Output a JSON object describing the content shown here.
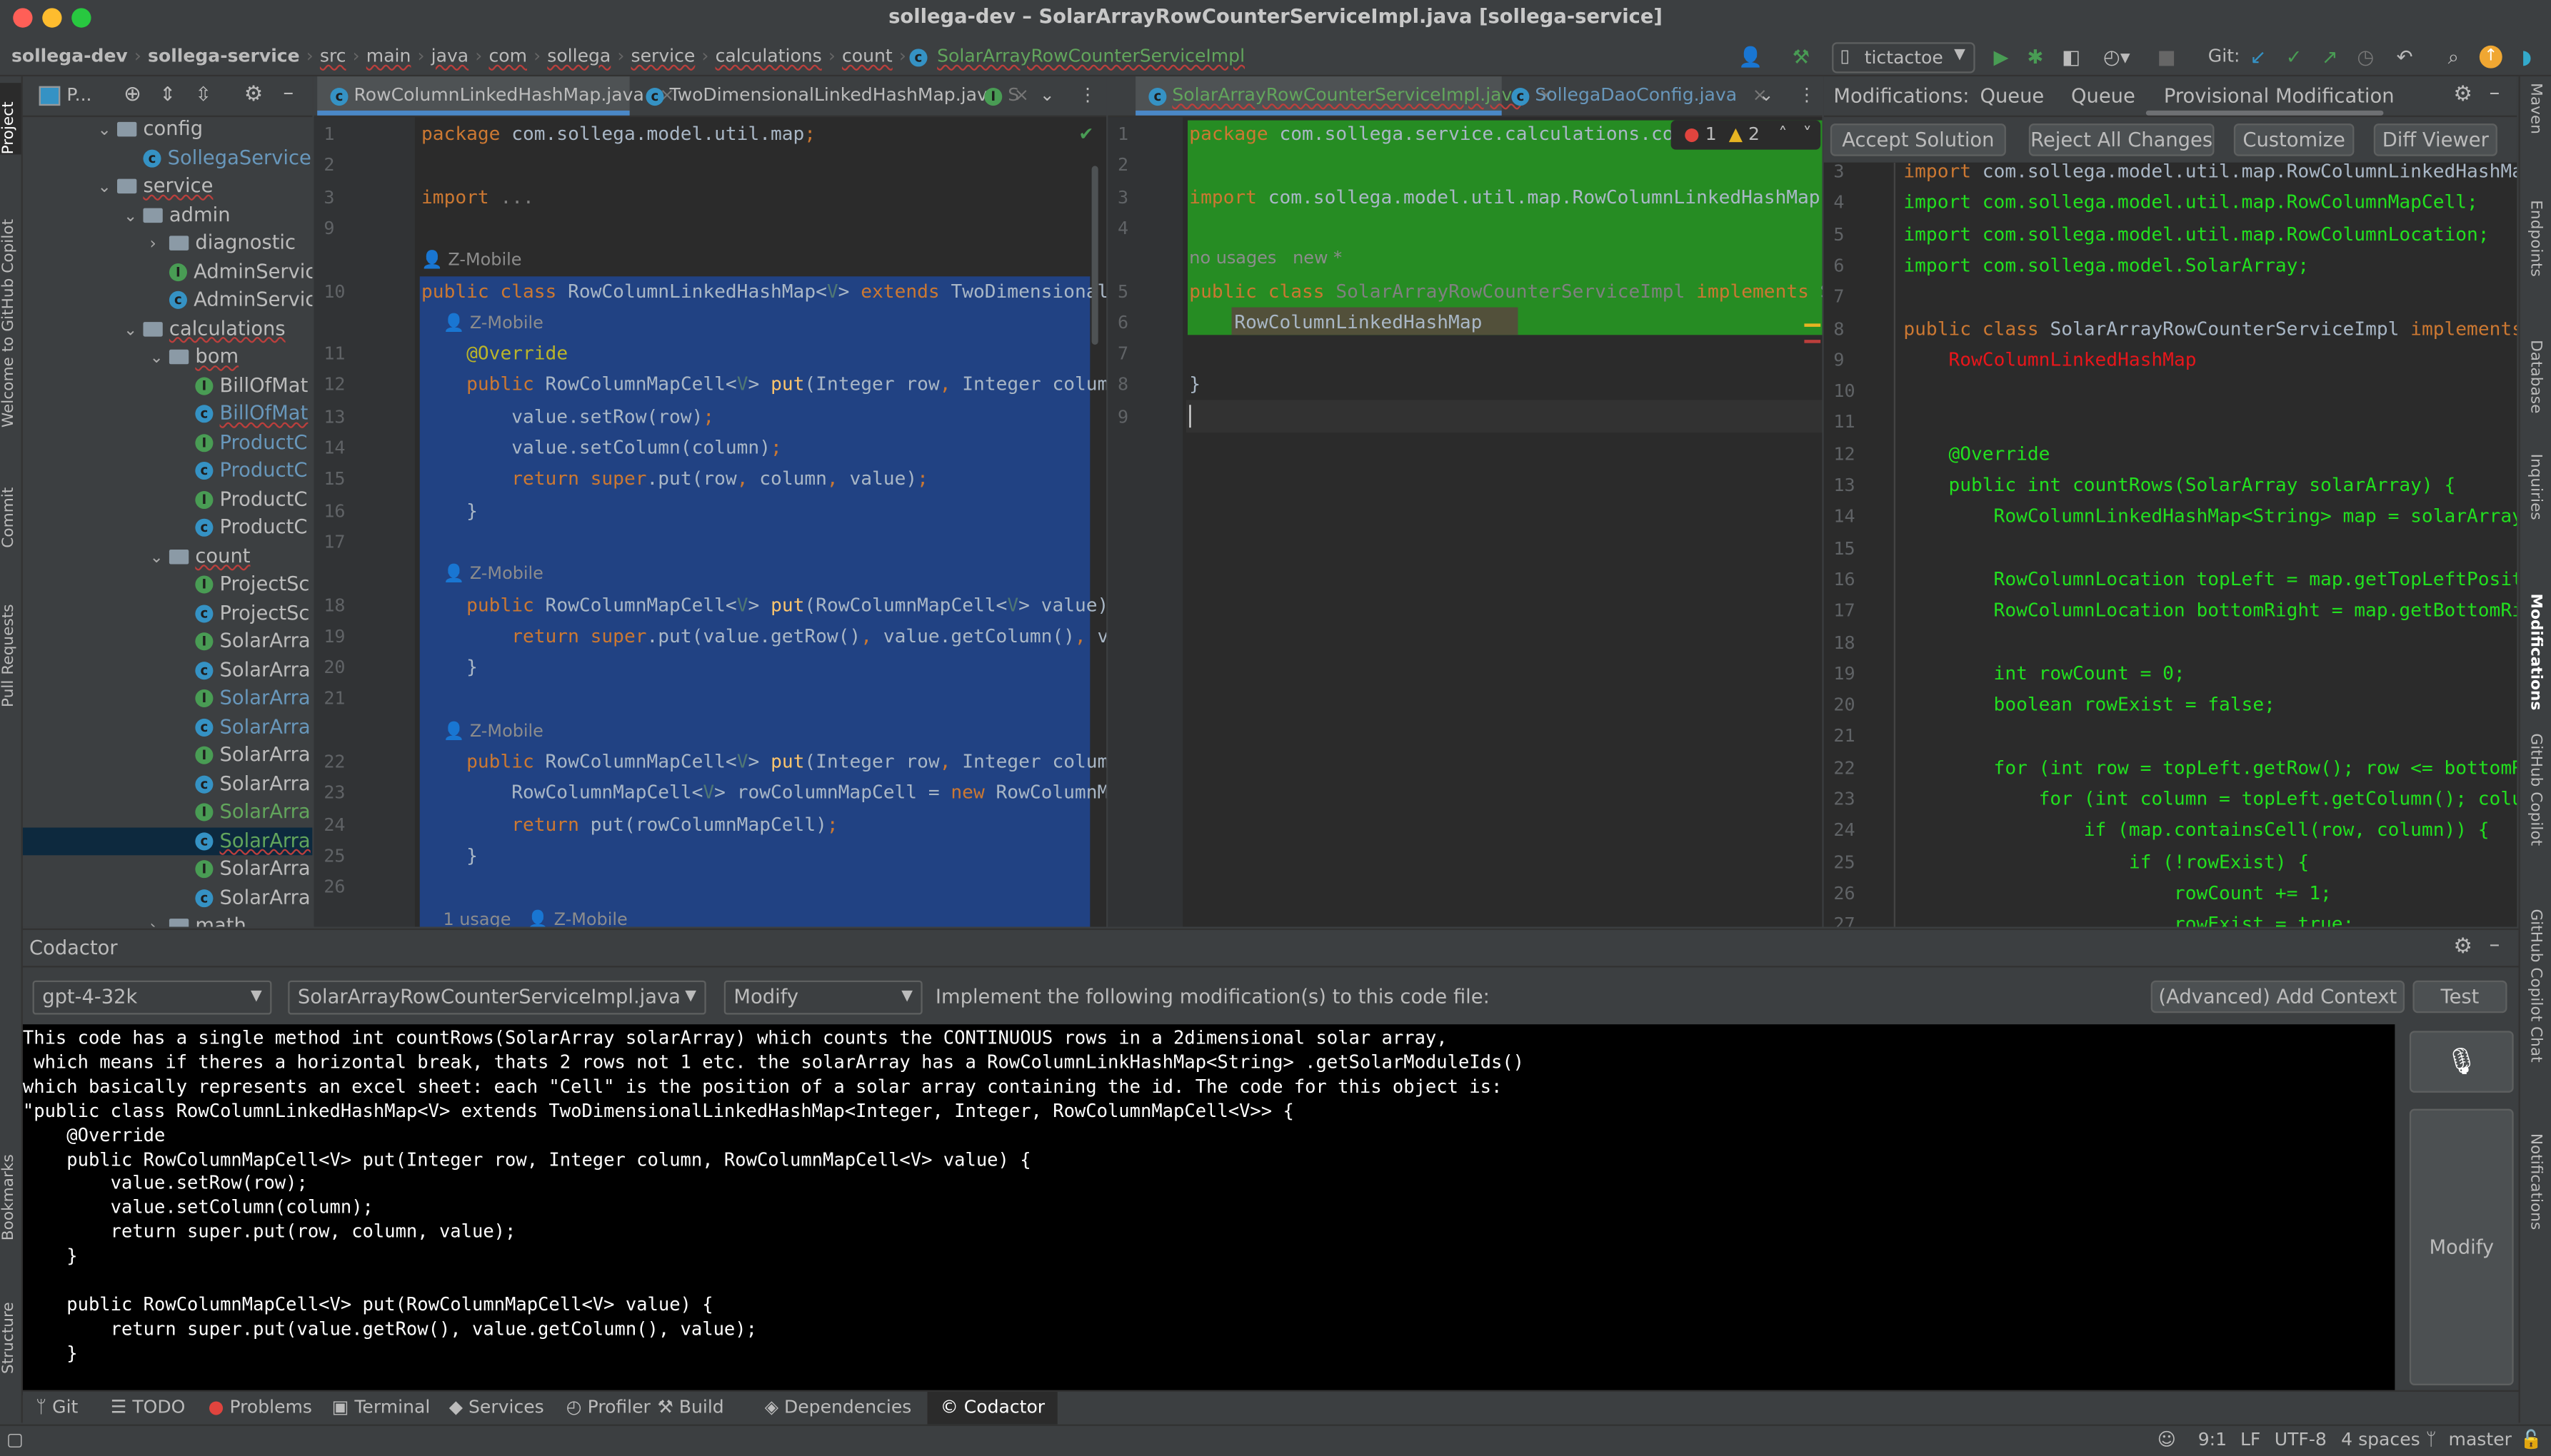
{
  "window": {
    "title": "sollega-dev – SolarArrayRowCounterServiceImpl.java [sollega-service]"
  },
  "breadcrumb": [
    "sollega-dev",
    "sollega-service",
    "src",
    "main",
    "java",
    "com",
    "sollega",
    "service",
    "calculations",
    "count",
    "SolarArrayRowCounterServiceImpl"
  ],
  "toolbar": {
    "run_config": "tictactoe",
    "git_label": "Git:"
  },
  "left_strip": [
    "Project",
    "Welcome to GitHub Copilot",
    "Commit",
    "Pull Requests",
    "Bookmarks",
    "Structure"
  ],
  "right_strip": [
    "Maven",
    "Endpoints",
    "Database",
    "Inquiries",
    "Modifications",
    "GitHub Copilot",
    "GitHub Copilot Chat",
    "Notifications"
  ],
  "project": {
    "title": "P...",
    "tree": [
      {
        "label": "config",
        "type": "folder",
        "depth": 0,
        "expanded": true
      },
      {
        "label": "SollegaService",
        "type": "class",
        "depth": 1,
        "color": "blue"
      },
      {
        "label": "service",
        "type": "folder",
        "depth": 0,
        "expanded": true,
        "underline": true
      },
      {
        "label": "admin",
        "type": "folder",
        "depth": 1,
        "expanded": true
      },
      {
        "label": "diagnostic",
        "type": "folder",
        "depth": 2,
        "expanded": false
      },
      {
        "label": "AdminServic",
        "type": "interface",
        "depth": 2
      },
      {
        "label": "AdminServic",
        "type": "class",
        "depth": 2
      },
      {
        "label": "calculations",
        "type": "folder",
        "depth": 1,
        "expanded": true,
        "underline": true
      },
      {
        "label": "bom",
        "type": "folder",
        "depth": 2,
        "expanded": true,
        "underline": true
      },
      {
        "label": "BillOfMat",
        "type": "interface",
        "depth": 3
      },
      {
        "label": "BillOfMat",
        "type": "class",
        "depth": 3,
        "color": "blue",
        "underline": true
      },
      {
        "label": "ProductC",
        "type": "interface",
        "depth": 3,
        "color": "blue"
      },
      {
        "label": "ProductC",
        "type": "class",
        "depth": 3,
        "color": "blue"
      },
      {
        "label": "ProductC",
        "type": "interface",
        "depth": 3
      },
      {
        "label": "ProductC",
        "type": "class",
        "depth": 3
      },
      {
        "label": "count",
        "type": "folder",
        "depth": 2,
        "expanded": true,
        "underline": true
      },
      {
        "label": "ProjectSc",
        "type": "interface",
        "depth": 3
      },
      {
        "label": "ProjectSc",
        "type": "class",
        "depth": 3
      },
      {
        "label": "SolarArra",
        "type": "interface",
        "depth": 3
      },
      {
        "label": "SolarArra",
        "type": "class",
        "depth": 3
      },
      {
        "label": "SolarArra",
        "type": "interface",
        "depth": 3,
        "color": "blue"
      },
      {
        "label": "SolarArra",
        "type": "class",
        "depth": 3,
        "color": "blue"
      },
      {
        "label": "SolarArra",
        "type": "interface",
        "depth": 3
      },
      {
        "label": "SolarArra",
        "type": "class",
        "depth": 3
      },
      {
        "label": "SolarArra",
        "type": "interface",
        "depth": 3,
        "color": "green"
      },
      {
        "label": "SolarArra",
        "type": "class",
        "depth": 3,
        "color": "green",
        "selected": true,
        "underline": true
      },
      {
        "label": "SolarArra",
        "type": "interface",
        "depth": 3
      },
      {
        "label": "SolarArra",
        "type": "class",
        "depth": 3
      },
      {
        "label": "math",
        "type": "folder",
        "depth": 2,
        "expanded": false
      }
    ]
  },
  "editor_left": {
    "tabs": [
      {
        "label": "RowColumnLinkedHashMap.java",
        "icon": "class",
        "active": true
      },
      {
        "label": "TwoDimensionalLinkedHashMap.java",
        "icon": "class"
      },
      {
        "label": "S",
        "icon": "interface"
      }
    ],
    "lines": [
      {
        "n": "1",
        "html": "<span class='kw'>package</span> com.sollega.model.util.map<span class='kw'>;</span>"
      },
      {
        "n": "2",
        "html": ""
      },
      {
        "n": "3",
        "html": "<span class='kw'>import</span> <span class='gr'>...</span>"
      },
      {
        "n": "9",
        "html": ""
      },
      {
        "hint": "Z-Mobile"
      },
      {
        "n": "10",
        "html": "<span class='kw'>public class</span> RowColumnLinkedHashMap&lt;<span class='tp'>V</span>&gt; <span class='kw'>extends</span> TwoDimensionalLinkedHashMap"
      },
      {
        "hint": "    Z-Mobile"
      },
      {
        "n": "11",
        "html": "    <span class='ann'>@Override</span>"
      },
      {
        "n": "12",
        "html": "    <span class='kw'>public</span> RowColumnMapCell&lt;<span class='tp'>V</span>&gt; <span class='fn'>put</span>(Integer row<span class='kw'>,</span> Integer column"
      },
      {
        "n": "13",
        "html": "        value.setRow(row)<span class='kw'>;</span>"
      },
      {
        "n": "14",
        "html": "        value.setColumn(column)<span class='kw'>;</span>"
      },
      {
        "n": "15",
        "html": "        <span class='kw'>return super</span>.put(row<span class='kw'>,</span> column<span class='kw'>,</span> value)<span class='kw'>;</span>"
      },
      {
        "n": "16",
        "html": "    }"
      },
      {
        "n": "17",
        "html": ""
      },
      {
        "hint": "    Z-Mobile"
      },
      {
        "n": "18",
        "html": "    <span class='kw'>public</span> RowColumnMapCell&lt;<span class='tp'>V</span>&gt; <span class='fn'>put</span>(RowColumnMapCell&lt;<span class='tp'>V</span>&gt; value) {"
      },
      {
        "n": "19",
        "html": "        <span class='kw'>return super</span>.put(value.getRow()<span class='kw'>,</span> value.getColumn()<span class='kw'>,</span> value)<span class='kw'>;</span>"
      },
      {
        "n": "20",
        "html": "    }"
      },
      {
        "n": "21",
        "html": ""
      },
      {
        "hint": "    Z-Mobile"
      },
      {
        "n": "22",
        "html": "    <span class='kw'>public</span> RowColumnMapCell&lt;<span class='tp'>V</span>&gt; <span class='fn'>put</span>(Integer row<span class='kw'>,</span> Integer column"
      },
      {
        "n": "23",
        "html": "        RowColumnMapCell&lt;<span class='tp'>V</span>&gt; rowColumnMapCell = <span class='kw'>new</span> RowColumnMapCell"
      },
      {
        "n": "24",
        "html": "        <span class='kw'>return</span> put(rowColumnMapCell)<span class='kw'>;</span>"
      },
      {
        "n": "25",
        "html": "    }"
      },
      {
        "n": "26",
        "html": ""
      },
      {
        "hint": "    1 usage   Z-Mobile"
      }
    ]
  },
  "editor_right": {
    "tabs": [
      {
        "label": "SolarArrayRowCounterServiceImpl.java",
        "icon": "class",
        "active": true
      },
      {
        "label": "SollegaDaoConfig.java",
        "icon": "class"
      }
    ],
    "inspections": {
      "errors": "1",
      "warnings": "2"
    },
    "lines": [
      {
        "n": "1",
        "html": "<span class='kw'>package</span> com.sollega.service.calculations.count<span class='kw'>;</span>"
      },
      {
        "n": "2",
        "html": ""
      },
      {
        "n": "3",
        "html": "<span class='kw'>import</span> com.sollega.model.util.map.RowColumnLinkedHashMap<span class='kw'>;</span>"
      },
      {
        "n": "4",
        "html": ""
      },
      {
        "hint": "no usages   new *"
      },
      {
        "n": "5",
        "html": "<span class='kw'>public class</span> <span class='gr'>SolarArrayRowCounterServiceImpl</span> <span class='kw'>implements</span> SolarArrayRowCounterService"
      },
      {
        "n": "6",
        "html": "    RowColumnLinkedHashMap"
      },
      {
        "n": "7",
        "html": ""
      },
      {
        "n": "8",
        "html": "}"
      },
      {
        "n": "9",
        "html": ""
      }
    ]
  },
  "modifications": {
    "label": "Modifications:",
    "tabs": [
      "Queue",
      "Queue",
      "Provisional Modification"
    ],
    "active_tab": 2,
    "buttons": [
      "Accept Solution",
      "Reject All Changes",
      "Customize",
      "Diff Viewer"
    ],
    "lines": [
      {
        "n": "3",
        "html": "<span class='kw'>import</span> com.sollega.model.util.map.RowColumnLinkedHashMap<span class='kw'>;</span>"
      },
      {
        "n": "4",
        "html": "<span class='gcode'>import com.sollega.model.util.map.RowColumnMapCell;</span>"
      },
      {
        "n": "5",
        "html": "<span class='gcode'>import com.sollega.model.util.map.RowColumnLocation;</span>"
      },
      {
        "n": "6",
        "html": "<span class='gcode'>import com.sollega.model.SolarArray;</span>"
      },
      {
        "n": "7",
        "html": ""
      },
      {
        "n": "8",
        "html": "<span class='kw'>public class</span> SolarArrayRowCounterServiceImpl <span class='kw'>implements</span> SolarArrayRowCounterService"
      },
      {
        "n": "9",
        "html": "    <span style='color:#e8161b'>RowColumnLinkedHashMap</span>"
      },
      {
        "n": "10",
        "html": ""
      },
      {
        "n": "11",
        "html": ""
      },
      {
        "n": "12",
        "html": "<span class='gcode'>    @Override</span>"
      },
      {
        "n": "13",
        "html": "<span class='gcode'>    public int countRows(SolarArray solarArray) {</span>"
      },
      {
        "n": "14",
        "html": "<span class='gcode'>        RowColumnLinkedHashMap&lt;String&gt; map = solarArray.getSolarModuleIds();</span>"
      },
      {
        "n": "15",
        "html": ""
      },
      {
        "n": "16",
        "html": "<span class='gcode'>        RowColumnLocation topLeft = map.getTopLeftPosition();</span>"
      },
      {
        "n": "17",
        "html": "<span class='gcode'>        RowColumnLocation bottomRight = map.getBottomRightPosition();</span>"
      },
      {
        "n": "18",
        "html": ""
      },
      {
        "n": "19",
        "html": "<span class='gcode'>        int rowCount = 0;</span>"
      },
      {
        "n": "20",
        "html": "<span class='gcode'>        boolean rowExist = false;</span>"
      },
      {
        "n": "21",
        "html": ""
      },
      {
        "n": "22",
        "html": "<span class='gcode'>        for (int row = topLeft.getRow(); row &lt;= bottomRight.getRow(); row++) {</span>"
      },
      {
        "n": "23",
        "html": "<span class='gcode'>            for (int column = topLeft.getColumn(); column &lt;= bottomRight.getColumn(); column++) {</span>"
      },
      {
        "n": "24",
        "html": "<span class='gcode'>                if (map.containsCell(row, column)) {</span>"
      },
      {
        "n": "25",
        "html": "<span class='gcode'>                    if (!rowExist) {</span>"
      },
      {
        "n": "26",
        "html": "<span class='gcode'>                        rowCount += 1;</span>"
      },
      {
        "n": "27",
        "html": "<span class='gcode'>                        rowExist = true;</span>"
      }
    ]
  },
  "codactor": {
    "title": "Codactor",
    "model": "gpt-4-32k",
    "file": "SolarArrayRowCounterServiceImpl.java",
    "action": "Modify",
    "instruction": "Implement the following modification(s) to this code file:",
    "add_context": "(Advanced) Add Context",
    "test": "Test",
    "submit": "Modify",
    "prompt": "This code has a single method int countRows(SolarArray solarArray) which counts the CONTINUOUS rows in a 2dimensional solar array,\n which means if theres a horizontal break, thats 2 rows not 1 etc. the solarArray has a RowColumnLinkHashMap<String> .getSolarModuleIds()\nwhich basically represents an excel sheet: each \"Cell\" is the position of a solar array containing the id. The code for this object is:\n\"public class RowColumnLinkedHashMap<V> extends TwoDimensionalLinkedHashMap<Integer, Integer, RowColumnMapCell<V>> {\n    @Override\n    public RowColumnMapCell<V> put(Integer row, Integer column, RowColumnMapCell<V> value) {\n        value.setRow(row);\n        value.setColumn(column);\n        return super.put(row, column, value);\n    }\n\n    public RowColumnMapCell<V> put(RowColumnMapCell<V> value) {\n        return super.put(value.getRow(), value.getColumn(), value);\n    }"
  },
  "tool_windows": [
    "Git",
    "TODO",
    "Problems",
    "Terminal",
    "Services",
    "Profiler",
    "Build",
    "Dependencies",
    "Codactor"
  ],
  "active_tool_window": "Codactor",
  "status": {
    "position": "9:1",
    "line_sep": "LF",
    "encoding": "UTF-8",
    "indent": "4 spaces",
    "branch": "master"
  },
  "colors": {
    "accent": "#4a88c7",
    "selection": "#214283",
    "added_block": "#268c23",
    "added_text": "#22e01f",
    "removed_text": "#e8161b"
  }
}
